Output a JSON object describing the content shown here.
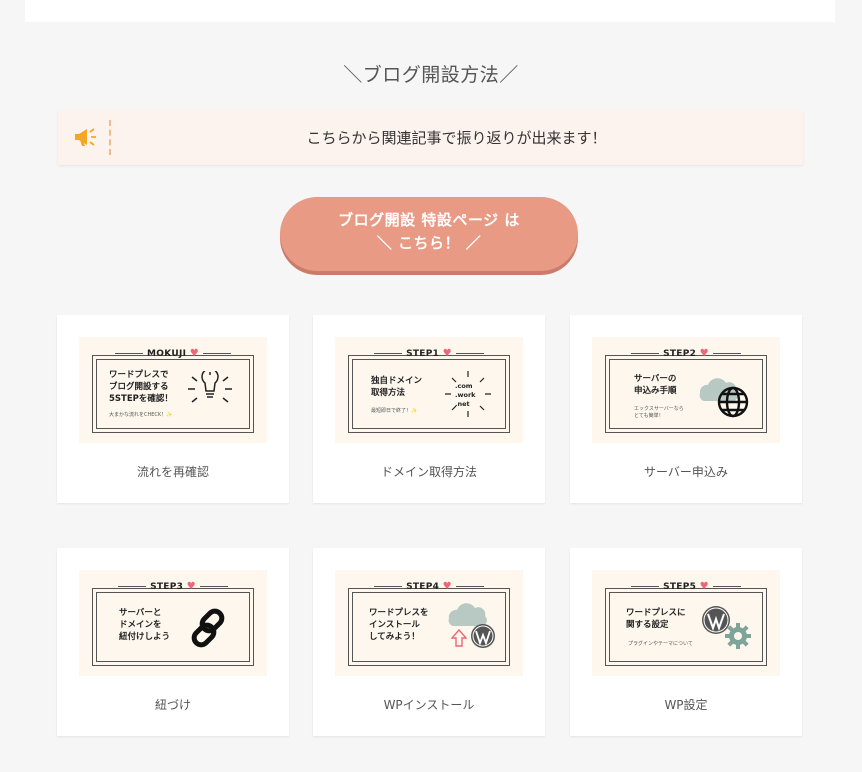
{
  "heading": "＼ブログ開設方法／",
  "notice": {
    "icon": "megaphone-icon",
    "text": "こちらから関連記事で振り返りが出来ます！"
  },
  "cta": {
    "line1": "ブログ開設 特設ページ は",
    "line2": "＼ こちら！ ／"
  },
  "colors": {
    "accent": "#e89a85",
    "notice_bg": "#fdf3ee",
    "icon": "#f5a623"
  },
  "cards": [
    {
      "tag": "MOKUJI",
      "thumb_text": [
        "ワードプレスで",
        "ブログ開設する",
        "5STEPを確認！"
      ],
      "thumb_small": "大まかな流れをCHECK！✨",
      "icon": "lightbulb-icon",
      "label": "流れを再確認"
    },
    {
      "tag": "STEP1",
      "thumb_text": [
        "独自ドメイン",
        "取得方法"
      ],
      "thumb_small": "最短即日で終了！✨",
      "icon": "domain-burst-icon",
      "domains": [
        ".com",
        ".work",
        ".net"
      ],
      "label": "ドメイン取得方法"
    },
    {
      "tag": "STEP2",
      "thumb_text": [
        "サーバーの",
        "申込み手順"
      ],
      "thumb_small": "エックスサーバーなら とても簡単！",
      "icon": "globe-icon",
      "label": "サーバー申込み"
    },
    {
      "tag": "STEP3",
      "thumb_text": [
        "サーバーと",
        "ドメインを",
        "紐付けしよう"
      ],
      "thumb_small": "",
      "icon": "link-icon",
      "label": "紐づけ"
    },
    {
      "tag": "STEP4",
      "thumb_text": [
        "ワードプレスを",
        "インストール",
        "してみよう！"
      ],
      "thumb_small": "",
      "icon": "wordpress-icon",
      "label": "WPインストール"
    },
    {
      "tag": "STEP5",
      "thumb_text": [
        "ワードプレスに",
        "関する設定"
      ],
      "thumb_small": "プラグインやテーマについて",
      "icon": "wordpress-gear-icon",
      "label": "WP設定"
    }
  ]
}
